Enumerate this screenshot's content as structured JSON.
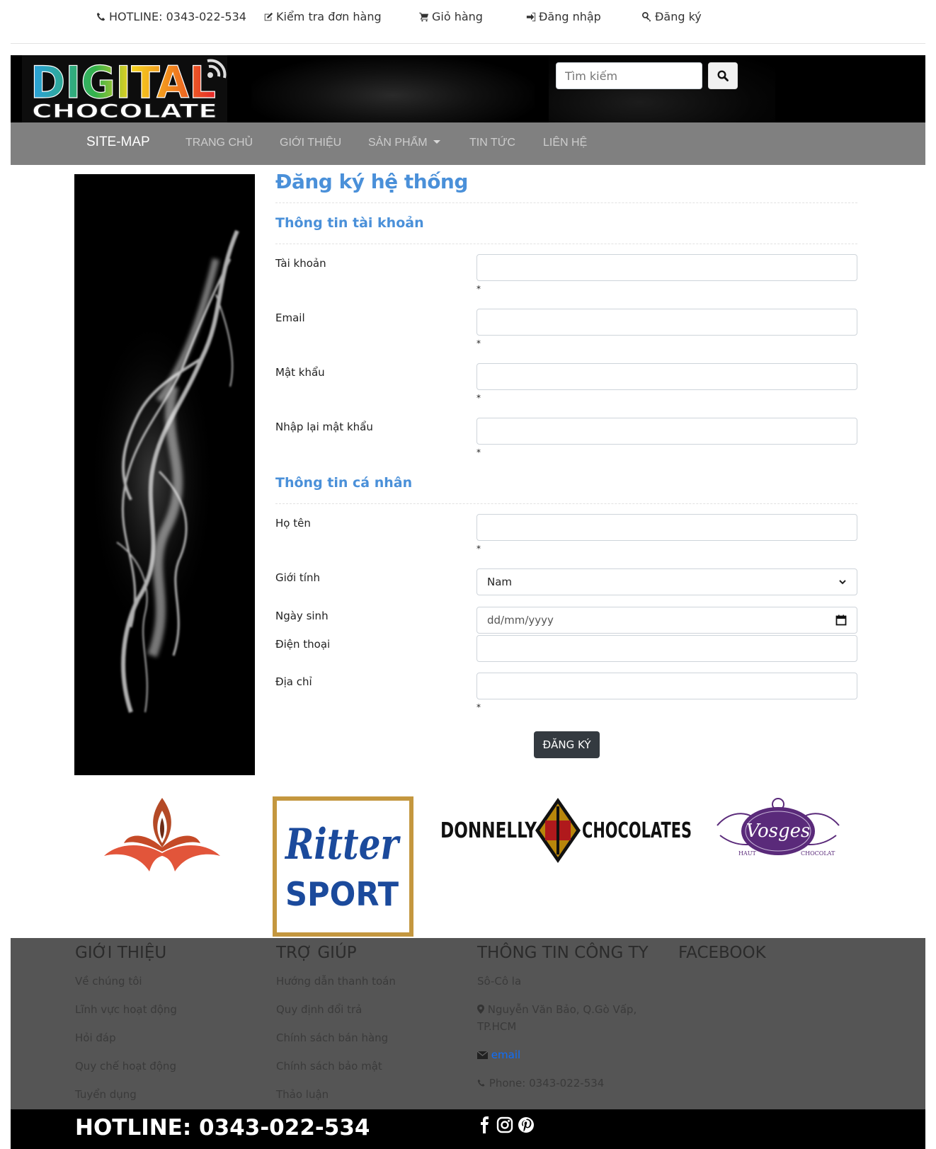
{
  "topbar": {
    "hotline": "HOTLINE: 0343-022-534",
    "check_order": "Kiểm tra đơn hàng",
    "cart": "Giỏ hàng",
    "login": "Đăng nhập",
    "register": "Đăng ký"
  },
  "logo": {
    "line1": "DIGITAL",
    "line2": "CHOCOLATE"
  },
  "search": {
    "placeholder": "Tìm kiếm"
  },
  "nav": {
    "brand": "SITE-MAP",
    "items": [
      "TRANG CHỦ",
      "GIỚI THIỆU",
      "SẢN PHẨM",
      "TIN TỨC",
      "LIÊN HỆ"
    ]
  },
  "form": {
    "title": "Đăng ký hệ thống",
    "section_account": "Thông tin tài khoản",
    "section_personal": "Thông tin cá nhân",
    "required_mark": "*",
    "labels": {
      "username": "Tài khoản",
      "email": "Email",
      "password": "Mật khẩu",
      "password_confirm": "Nhập lại mật khẩu",
      "fullname": "Họ tên",
      "gender": "Giới tính",
      "birthday": "Ngày sinh",
      "phone": "Điện thoại",
      "address": "Địa chỉ"
    },
    "gender_selected": "Nam",
    "birthday_placeholder": "dd/mm/yyyy",
    "submit": "ĐĂNG KÝ"
  },
  "brands": {
    "ritter_line1": "Ritter",
    "ritter_line2": "SPORT",
    "donnelly_left": "DONNELLY",
    "donnelly_right": "CHOCOLATES",
    "vosges": "Vosges",
    "vosges_left": "HAUT",
    "vosges_right": "CHOCOLAT"
  },
  "footer": {
    "about": {
      "title": "GIỚI THIỆU",
      "links": [
        "Về chúng tôi",
        "Lĩnh vực hoạt động",
        "Hỏi đáp",
        "Quy chế hoạt động",
        "Tuyển dụng"
      ]
    },
    "help": {
      "title": "TRỢ GIÚP",
      "links": [
        "Hướng dẫn thanh toán",
        "Quy định đổi trả",
        "Chính sách bán hàng",
        "Chính sách bảo mật",
        "Thảo luận"
      ]
    },
    "company": {
      "title": "THÔNG TIN CÔNG TY",
      "name": "Sô-Cô la",
      "address_line1": "Nguyễn Văn Bảo, Q.Gò Vấp,",
      "address_line2": "TP.HCM",
      "email": "email",
      "phone": "Phone: 0343-022-534"
    },
    "facebook": {
      "title": "FACEBOOK"
    },
    "hotline": "HOTLINE: 0343-022-534"
  }
}
